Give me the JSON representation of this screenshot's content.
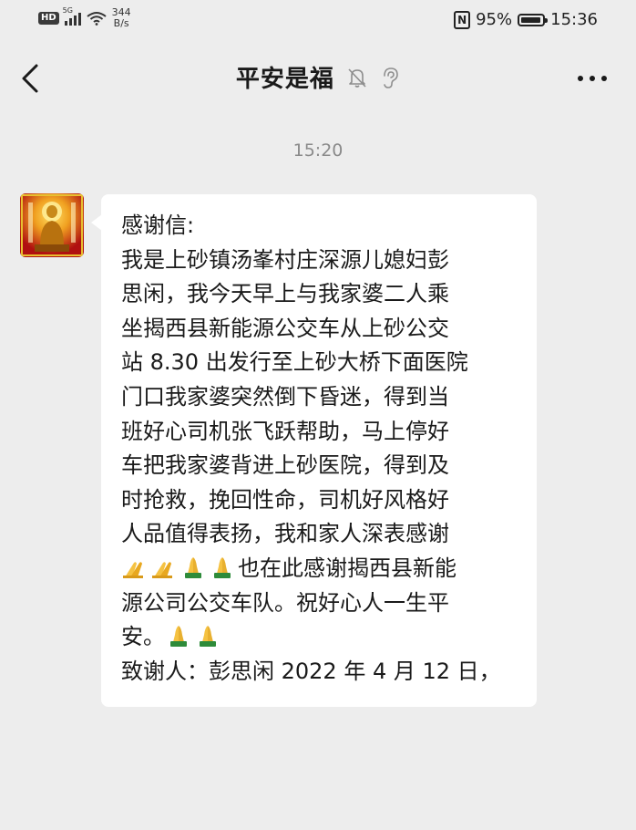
{
  "status_bar": {
    "hd": "HD",
    "network": "5G",
    "speed_value": "344",
    "speed_unit": "B/s",
    "nfc": "N",
    "battery": "95%",
    "time": "15:36"
  },
  "nav": {
    "title": "平安是福",
    "icons": [
      "back-icon",
      "mute-bell-icon",
      "ear-icon",
      "more-icon"
    ]
  },
  "chat": {
    "timestamp": "15:20",
    "message": {
      "line1": "感谢信:",
      "line2": "我是上砂镇汤峯村庄深源儿媳妇彭",
      "line3": "思闲，我今天早上与我家婆二人乘",
      "line4": "坐揭西县新能源公交车从上砂公交",
      "line5": "站 8.30 出发行至上砂大桥下面医院",
      "line6": "门口我家婆突然倒下昏迷，得到当",
      "line7": "班好心司机张飞跃帮助，马上停好",
      "line8": "车把我家婆背进上砂医院，得到及",
      "line9": "时抢救，挽回性命，司机好风格好",
      "line10": "人品值得表扬，我和家人深表感谢",
      "line11": "也在此感谢揭西县新能",
      "line12": "源公司公交车队。祝好心人一生平",
      "line13": "安。",
      "line14": "致谢人：彭思闲 2022 年 4 月 12 日，"
    }
  },
  "colors": {
    "background": "#ededed",
    "bubble": "#ffffff",
    "text": "#1a1a1a",
    "timestamp": "#8a8a8a"
  }
}
